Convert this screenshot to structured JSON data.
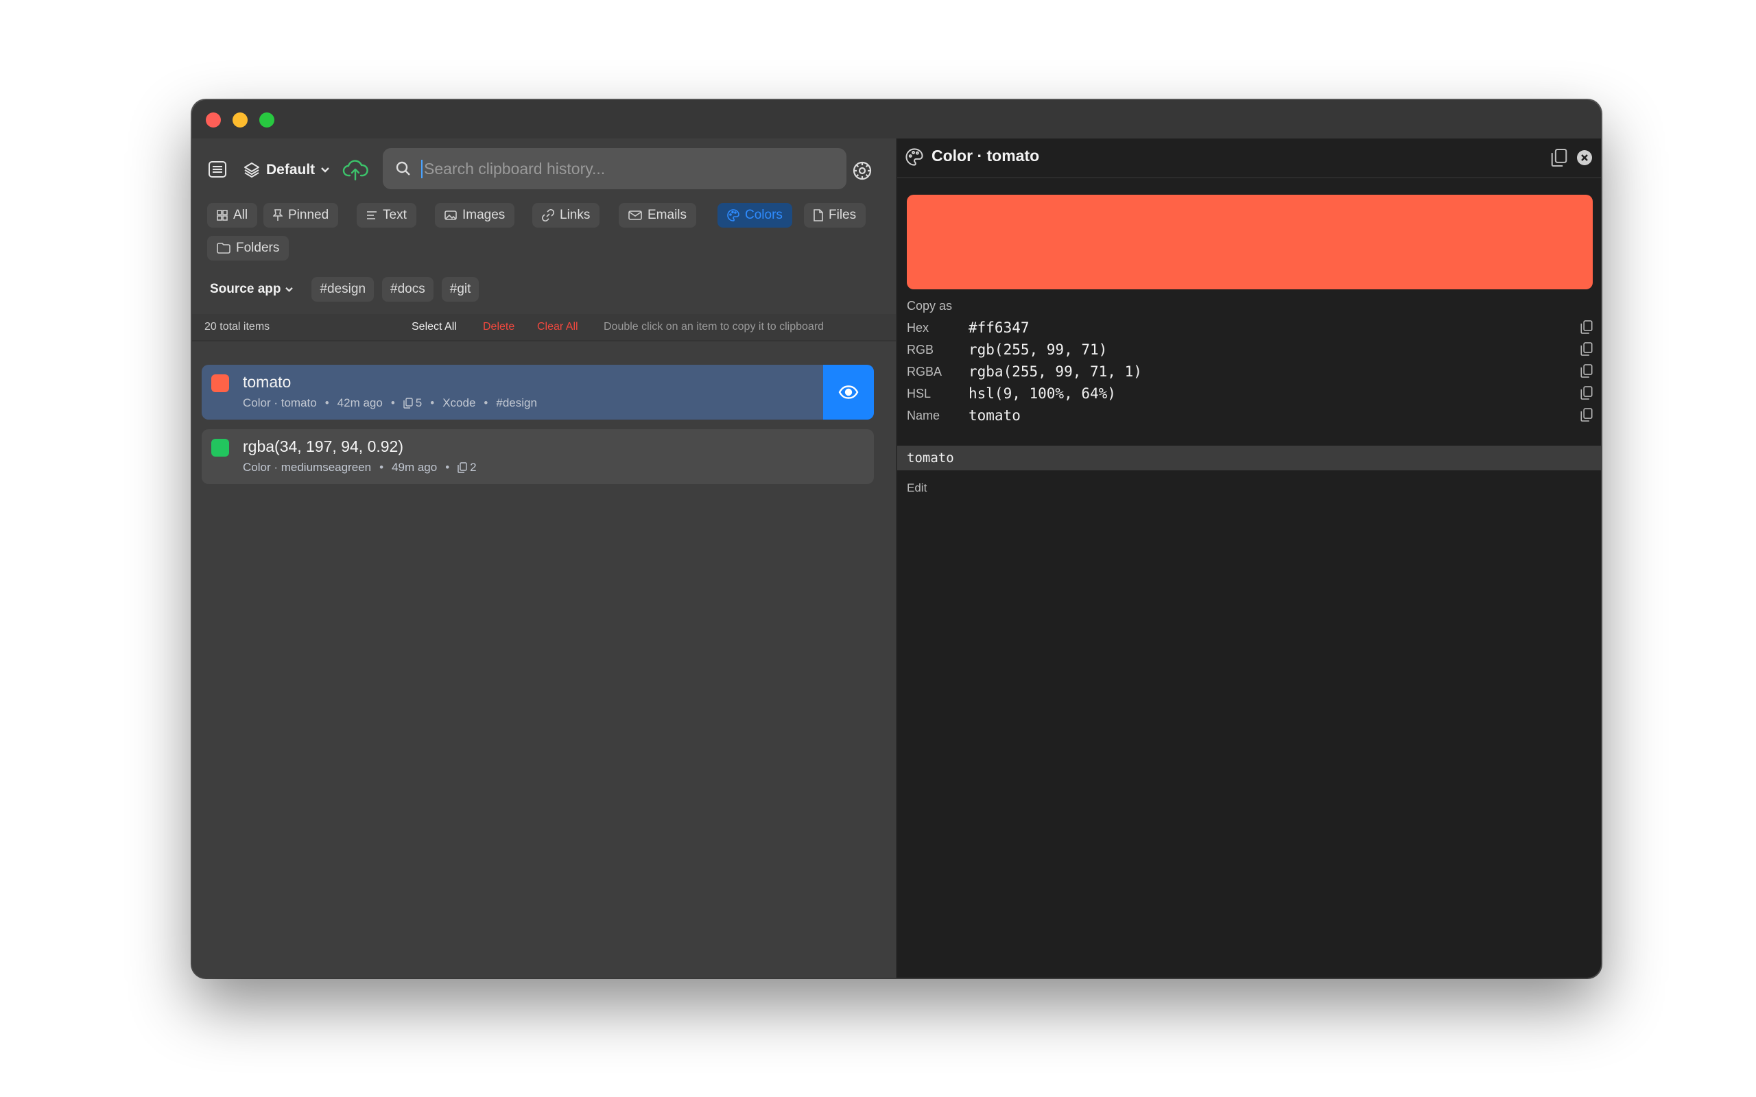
{
  "toolbar": {
    "profile_label": "Default",
    "search_placeholder": "Search clipboard history..."
  },
  "filters": [
    {
      "label": "All",
      "icon": "grid-icon"
    },
    {
      "label": "Pinned",
      "icon": "pin-icon"
    },
    {
      "label": "Text",
      "icon": "text-lines-icon"
    },
    {
      "label": "Images",
      "icon": "image-icon"
    },
    {
      "label": "Links",
      "icon": "link-icon"
    },
    {
      "label": "Emails",
      "icon": "envelope-icon"
    },
    {
      "label": "Colors",
      "icon": "palette-icon",
      "active": true
    },
    {
      "label": "Files",
      "icon": "file-icon"
    },
    {
      "label": "Folders",
      "icon": "folder-icon"
    }
  ],
  "tags": {
    "source_app": "Source app",
    "items": [
      "#design",
      "#docs",
      "#git"
    ]
  },
  "status": {
    "total": "20 total items",
    "select_all": "Select All",
    "delete": "Delete",
    "clear_all": "Clear All",
    "hint": "Double click on an item to copy it to clipboard"
  },
  "items": [
    {
      "title": "tomato",
      "kind": "Color · tomato",
      "age": "42m ago",
      "copies": "5",
      "app": "Xcode",
      "tag": "#design",
      "color": "#ff6347"
    },
    {
      "title": "rgba(34, 197, 94, 0.92)",
      "kind": "Color · mediumseagreen",
      "age": "49m ago",
      "copies": "2",
      "color": "#22c55e"
    }
  ],
  "detail": {
    "title": "Color · tomato",
    "swatch_color": "#ff6347",
    "copy_as": "Copy as",
    "rows": [
      {
        "key": "Hex",
        "value": "#ff6347"
      },
      {
        "key": "RGB",
        "value": "rgb(255, 99, 71)"
      },
      {
        "key": "RGBA",
        "value": "rgba(255, 99, 71, 1)"
      },
      {
        "key": "HSL",
        "value": "hsl(9, 100%, 64%)"
      },
      {
        "key": "Name",
        "value": "tomato"
      }
    ],
    "name_value": "tomato",
    "edit": "Edit"
  },
  "colors": {
    "accent": "#1a84ff",
    "danger": "#f0483e",
    "cloud": "#3cc46b"
  }
}
